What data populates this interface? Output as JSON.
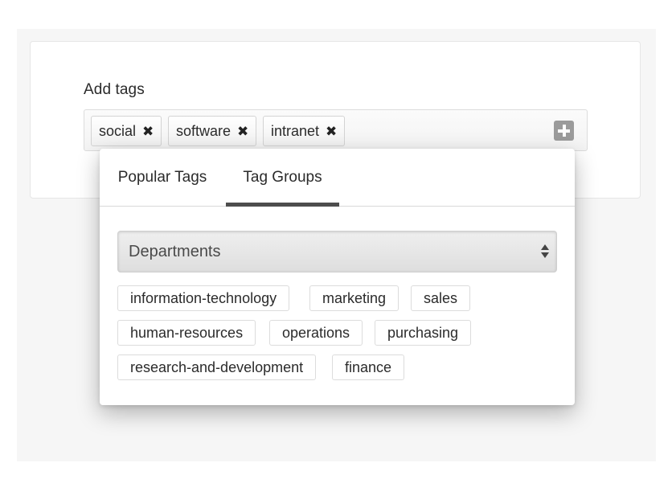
{
  "field": {
    "label": "Add tags"
  },
  "selected_tags": [
    {
      "label": "social",
      "remove_icon": "close-icon"
    },
    {
      "label": "software",
      "remove_icon": "close-icon"
    },
    {
      "label": "intranet",
      "remove_icon": "close-icon"
    }
  ],
  "add_button": {
    "icon": "plus-square-icon"
  },
  "popover": {
    "tabs": [
      {
        "label": "Popular Tags",
        "active": false
      },
      {
        "label": "Tag Groups",
        "active": true
      }
    ],
    "group_select": {
      "value": "Departments",
      "icon": "select-arrows-icon"
    },
    "group_tags": [
      "information-technology",
      "marketing",
      "sales",
      "human-resources",
      "operations",
      "purchasing",
      "research-and-development",
      "finance"
    ]
  },
  "colors": {
    "active_tab_underline": "#4d4d4d",
    "add_button": "#9b9b9b",
    "background": "#f6f6f6"
  }
}
